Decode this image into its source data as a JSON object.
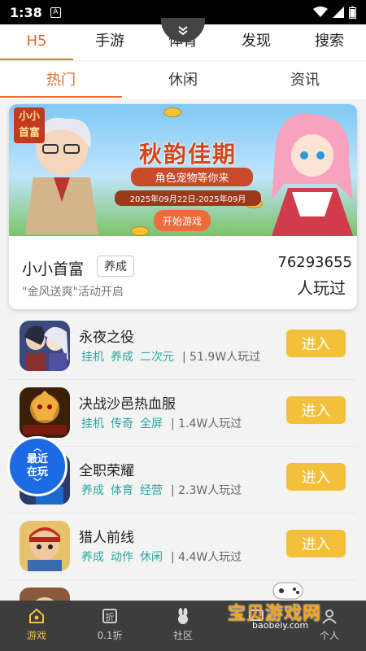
{
  "status_bar": {
    "time": "1:38",
    "sim_label": "A"
  },
  "top_tabs": [
    {
      "label": "H5",
      "active": true
    },
    {
      "label": "手游",
      "active": false
    },
    {
      "label": "体育",
      "active": false
    },
    {
      "label": "发现",
      "active": false
    },
    {
      "label": "搜索",
      "active": false
    }
  ],
  "sub_tabs": [
    {
      "label": "热门",
      "active": true
    },
    {
      "label": "休闲",
      "active": false
    },
    {
      "label": "资讯",
      "active": false
    }
  ],
  "featured": {
    "banner": {
      "logo": "小小首富",
      "title": "秋韵佳期",
      "subtitle": "角色宠物等你来",
      "dates": "2025年09月22日-2025年09月",
      "button": "开始游戏"
    },
    "name": "小小首富",
    "tag": "养成",
    "desc": "\"金风送爽\"活动开启",
    "play_count": "76293655",
    "play_count_label": "人玩过"
  },
  "games": [
    {
      "name": "永夜之役",
      "tags": [
        "挂机",
        "养成",
        "二次元"
      ],
      "plays": "| 51.9W人玩过",
      "button": "进入"
    },
    {
      "name": "决战沙邑热血服",
      "tags": [
        "挂机",
        "传奇",
        "全屏"
      ],
      "plays": "| 1.4W人玩过",
      "button": "进入"
    },
    {
      "name": "全职荣耀",
      "tags": [
        "养成",
        "体育",
        "经营"
      ],
      "plays": "| 2.3W人玩过",
      "button": "进入"
    },
    {
      "name": "猎人前线",
      "tags": [
        "养成",
        "动作",
        "休闲"
      ],
      "plays": "| 4.4W人玩过",
      "button": "进入"
    }
  ],
  "recent_float": {
    "line1": "最近",
    "line2": "在玩"
  },
  "bottom_nav": [
    {
      "label": "游戏",
      "icon": "home-icon",
      "active": true
    },
    {
      "label": "0.1折",
      "icon": "discount-icon",
      "active": false
    },
    {
      "label": "社区",
      "icon": "rabbit-icon",
      "active": false
    },
    {
      "label": "",
      "icon": "message-icon",
      "active": false
    },
    {
      "label": "个人",
      "icon": "person-icon",
      "active": false
    }
  ],
  "watermark": {
    "text": "宝贝游戏网",
    "url": "baobeiy.com"
  },
  "colors": {
    "accent": "#ea6b2a",
    "button": "#f3c03a",
    "tag": "#2aa7a0",
    "float": "#1c6be3",
    "nav_bg": "#3d3d3d"
  }
}
